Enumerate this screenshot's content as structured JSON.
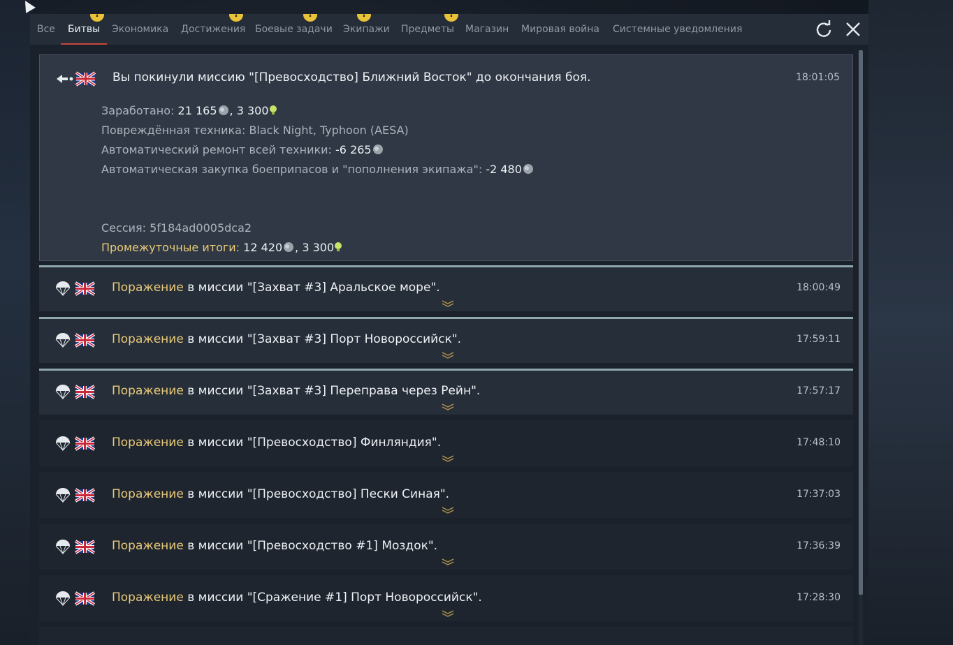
{
  "tabs": [
    {
      "label": "Все",
      "alert": false,
      "active": false
    },
    {
      "label": "Битвы",
      "alert": true,
      "active": true
    },
    {
      "label": "Экономика",
      "alert": false,
      "active": false
    },
    {
      "label": "Достижения",
      "alert": true,
      "active": false
    },
    {
      "label": "Боевые задачи",
      "alert": true,
      "active": false
    },
    {
      "label": "Экипажи",
      "alert": true,
      "active": false
    },
    {
      "label": "Предметы",
      "alert": true,
      "active": false
    },
    {
      "label": "Магазин",
      "alert": true,
      "active": false
    },
    {
      "label": "Мировая война",
      "alert": false,
      "active": false
    },
    {
      "label": "Системные уведомления",
      "alert": false,
      "active": false
    }
  ],
  "badge_glyph": "!",
  "icons": {
    "refresh": "refresh-icon",
    "close": "close-icon",
    "leave": "leave-mission-icon",
    "defeat": "parachute-icon",
    "flag": "uk-flag-icon",
    "lions": "silver-lions-icon",
    "rp": "research-points-icon",
    "expand": "chevron-down-icon"
  },
  "colors": {
    "accent_underline": "#c8463a",
    "highlight": "#e8c978",
    "badge": "#e9c23a",
    "row_topline": "#8fa7ad"
  },
  "expanded": {
    "title": "Вы покинули миссию \"[Превосходство] Ближний Восток\" до окончания боя.",
    "time": "18:01:05",
    "earned_label": "Заработано: ",
    "earned_lions": "21 165",
    "earned_sep": ", ",
    "earned_rp": "3 300",
    "damaged_label": "Повреждённая техника: ",
    "damaged_value": "Black Night, Typhoon (AESA)",
    "repair_label": "Автоматический ремонт всей техники: ",
    "repair_value": "-6 265",
    "ammo_label": "Автоматическая закупка боеприпасов и \"пополнения экипажа\": ",
    "ammo_value": "-2 480",
    "session_label": "Сессия: ",
    "session_value": "5f184ad0005dca2",
    "subtotal_label": "Промежуточные итоги: ",
    "subtotal_lions": "12 420",
    "subtotal_sep": ", ",
    "subtotal_rp": "3 300"
  },
  "rows": [
    {
      "result": "Поражение",
      "text": " в миссии \"[Захват #3] Аральское море\".",
      "time": "18:00:49"
    },
    {
      "result": "Поражение",
      "text": " в миссии \"[Захват #3] Порт Новороссийск\".",
      "time": "17:59:11"
    },
    {
      "result": "Поражение",
      "text": " в миссии \"[Захват #3] Переправа через Рейн\".",
      "time": "17:57:17"
    },
    {
      "result": "Поражение",
      "text": " в миссии \"[Превосходство] Финляндия\".",
      "time": "17:48:10"
    },
    {
      "result": "Поражение",
      "text": " в миссии \"[Превосходство] Пески Синая\".",
      "time": "17:37:03"
    },
    {
      "result": "Поражение",
      "text": " в миссии \"[Превосходство #1] Моздок\".",
      "time": "17:36:39"
    },
    {
      "result": "Поражение",
      "text": " в миссии \"[Сражение #1] Порт Новороссийск\".",
      "time": "17:28:30"
    }
  ]
}
